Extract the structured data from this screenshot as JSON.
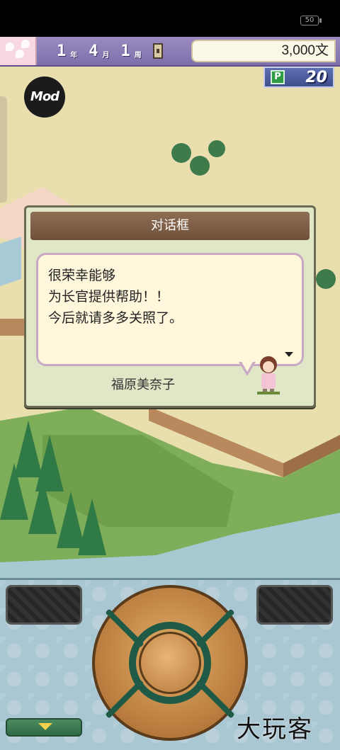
{
  "status_bar": {
    "battery_level": "50"
  },
  "hud": {
    "year_value": "1",
    "year_unit": "年",
    "month_value": "4",
    "month_unit": "月",
    "week_value": "1",
    "week_unit": "周",
    "money": "3,000文"
  },
  "points": {
    "icon_label": "P",
    "value": "20"
  },
  "mod_button": {
    "label": "Mod"
  },
  "dialog": {
    "title": "对话框",
    "text": "很荣幸能够\n为长官提供帮助！！\n今后就请多多关照了。",
    "speaker": "福原美奈子"
  },
  "watermark": {
    "text": "大玩客"
  },
  "icons": {
    "battery": "battery-icon",
    "points": "p-points-icon",
    "advance": "triangle-down-icon",
    "lantern": "lantern-icon",
    "menu": "triangle-down-icon"
  },
  "colors": {
    "hud": "#7d6fab",
    "dialog_title": "#6e5039",
    "bubble": "#fff7dc",
    "controls_bg": "#a9c6d3",
    "points_bg": "#3f4f8e"
  }
}
